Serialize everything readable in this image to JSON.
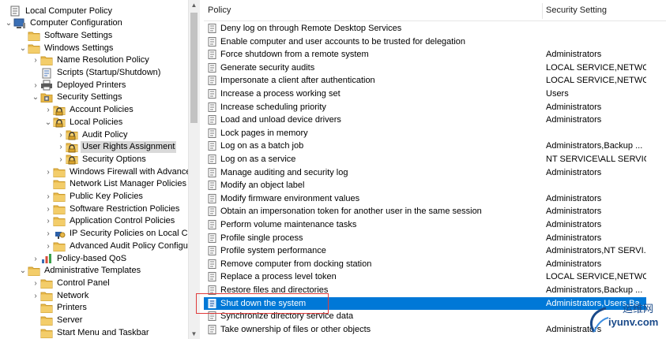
{
  "tree": {
    "items": [
      {
        "label": "Local Computer Policy",
        "icon": "policy-document-icon",
        "chev": ""
      },
      {
        "label": "Computer Configuration",
        "icon": "computer-icon",
        "chev": "open"
      },
      {
        "label": "Software Settings",
        "icon": "folder-icon",
        "chev": ""
      },
      {
        "label": "Windows Settings",
        "icon": "folder-icon",
        "chev": "open"
      },
      {
        "label": "Name Resolution Policy",
        "icon": "folder-icon",
        "chev": "closed"
      },
      {
        "label": "Scripts (Startup/Shutdown)",
        "icon": "script-icon",
        "chev": ""
      },
      {
        "label": "Deployed Printers",
        "icon": "printer-icon",
        "chev": "closed"
      },
      {
        "label": "Security Settings",
        "icon": "security-settings-icon",
        "chev": "open"
      },
      {
        "label": "Account Policies",
        "icon": "security-folder-icon",
        "chev": "closed"
      },
      {
        "label": "Local Policies",
        "icon": "security-folder-icon",
        "chev": "open"
      },
      {
        "label": "Audit Policy",
        "icon": "security-folder-icon",
        "chev": "closed"
      },
      {
        "label": "User Rights Assignment",
        "icon": "security-folder-icon",
        "chev": "closed",
        "selected": true
      },
      {
        "label": "Security Options",
        "icon": "security-folder-icon",
        "chev": "closed"
      },
      {
        "label": "Windows Firewall with Advanced",
        "icon": "folder-icon",
        "chev": "closed"
      },
      {
        "label": "Network List Manager Policies",
        "icon": "folder-icon",
        "chev": ""
      },
      {
        "label": "Public Key Policies",
        "icon": "folder-icon",
        "chev": "closed"
      },
      {
        "label": "Software Restriction Policies",
        "icon": "folder-icon",
        "chev": "closed"
      },
      {
        "label": "Application Control Policies",
        "icon": "folder-icon",
        "chev": "closed"
      },
      {
        "label": "IP Security Policies on Local Con",
        "icon": "ipsec-icon",
        "chev": "closed"
      },
      {
        "label": "Advanced Audit Policy Configur",
        "icon": "folder-icon",
        "chev": "closed"
      },
      {
        "label": "Policy-based QoS",
        "icon": "chart-icon",
        "chev": "closed"
      },
      {
        "label": "Administrative Templates",
        "icon": "folder-icon",
        "chev": "open"
      },
      {
        "label": "Control Panel",
        "icon": "folder-icon",
        "chev": "closed"
      },
      {
        "label": "Network",
        "icon": "folder-icon",
        "chev": "closed"
      },
      {
        "label": "Printers",
        "icon": "folder-icon",
        "chev": ""
      },
      {
        "label": "Server",
        "icon": "folder-icon",
        "chev": ""
      },
      {
        "label": "Start Menu and Taskbar",
        "icon": "folder-icon",
        "chev": ""
      }
    ]
  },
  "list": {
    "col_policy": "Policy",
    "col_setting": "Security Setting",
    "rows": [
      {
        "policy": "Deny log on through Remote Desktop Services",
        "setting": ""
      },
      {
        "policy": "Enable computer and user accounts to be trusted for delegation",
        "setting": ""
      },
      {
        "policy": "Force shutdown from a remote system",
        "setting": "Administrators"
      },
      {
        "policy": "Generate security audits",
        "setting": "LOCAL SERVICE,NETWO..."
      },
      {
        "policy": "Impersonate a client after authentication",
        "setting": "LOCAL SERVICE,NETWO..."
      },
      {
        "policy": "Increase a process working set",
        "setting": "Users"
      },
      {
        "policy": "Increase scheduling priority",
        "setting": "Administrators"
      },
      {
        "policy": "Load and unload device drivers",
        "setting": "Administrators"
      },
      {
        "policy": "Lock pages in memory",
        "setting": ""
      },
      {
        "policy": "Log on as a batch job",
        "setting": "Administrators,Backup ..."
      },
      {
        "policy": "Log on as a service",
        "setting": "NT SERVICE\\ALL SERVIC..."
      },
      {
        "policy": "Manage auditing and security log",
        "setting": "Administrators"
      },
      {
        "policy": "Modify an object label",
        "setting": ""
      },
      {
        "policy": "Modify firmware environment values",
        "setting": "Administrators"
      },
      {
        "policy": "Obtain an impersonation token for another user in the same session",
        "setting": "Administrators"
      },
      {
        "policy": "Perform volume maintenance tasks",
        "setting": "Administrators"
      },
      {
        "policy": "Profile single process",
        "setting": "Administrators"
      },
      {
        "policy": "Profile system performance",
        "setting": "Administrators,NT SERVI..."
      },
      {
        "policy": "Remove computer from docking station",
        "setting": "Administrators"
      },
      {
        "policy": "Replace a process level token",
        "setting": "LOCAL SERVICE,NETWO..."
      },
      {
        "policy": "Restore files and directories",
        "setting": "Administrators,Backup ..."
      },
      {
        "policy": "Shut down the system",
        "setting": "Administrators,Users,Ba...",
        "selected": true
      },
      {
        "policy": "Synchronize directory service data",
        "setting": ""
      },
      {
        "policy": "Take ownership of files or other objects",
        "setting": "Administrators"
      }
    ]
  },
  "watermark": {
    "cn": "运维网",
    "url": "iyunv.com"
  },
  "colors": {
    "selection": "#0078d7",
    "tree_selection": "#d9d9d9",
    "highlight_box": "#e03c3c",
    "folder": "#e8b84a"
  }
}
